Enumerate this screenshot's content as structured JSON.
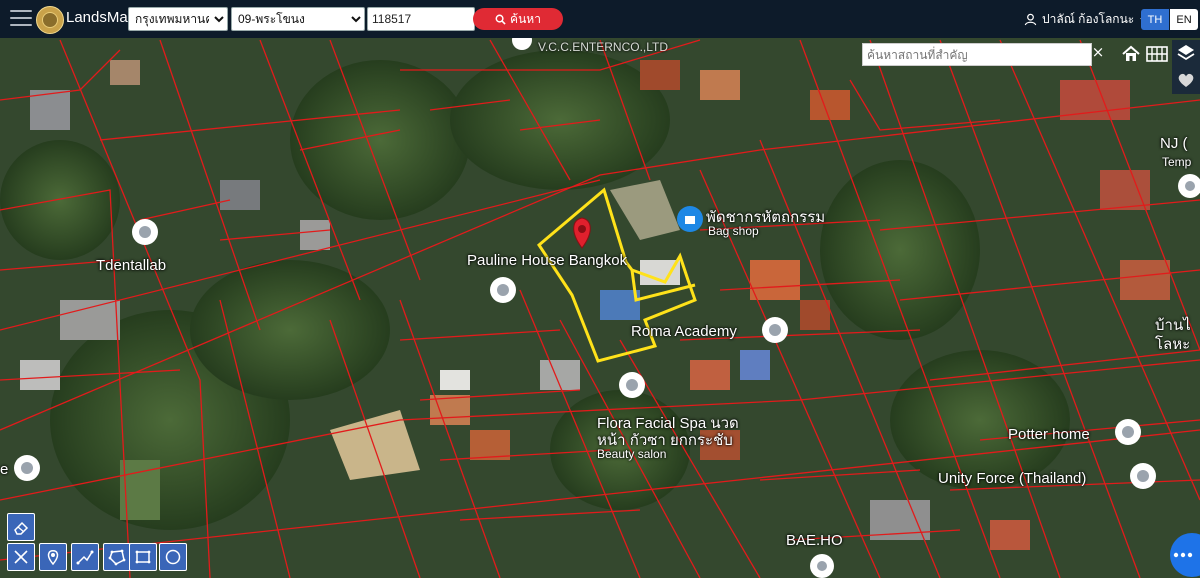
{
  "app": {
    "title": "LandsMaps"
  },
  "search": {
    "province": "กรุงเทพมหานคร",
    "district": "09-พระโขนง",
    "parcel_number": "118517",
    "button_label": "ค้นหา"
  },
  "user": {
    "name": "ปาลัณ์ ก้องโลกนะ"
  },
  "language": {
    "th": "TH",
    "en": "EN"
  },
  "map": {
    "place_search_placeholder": "ค้นหาสถานที่สำคัญ",
    "clear_symbol": "×",
    "labels": [
      {
        "text": "Tdentallab"
      },
      {
        "text": "Pauline House Bangkok"
      },
      {
        "text": "พัดชากรหัตถกรรม"
      },
      {
        "text": "Bag shop"
      },
      {
        "text": "Roma Academy"
      },
      {
        "text": "Flora Facial Spa นวด"
      },
      {
        "text": "หน้า กัวซา ยกกระชับ"
      },
      {
        "text": "Beauty salon"
      },
      {
        "text": "Potter home"
      },
      {
        "text": "Unity Force (Thailand)"
      },
      {
        "text": "BAE.HO"
      },
      {
        "text": "NJ ("
      },
      {
        "text": "Temp"
      },
      {
        "text": "บ้านไ"
      },
      {
        "text": "โลหะ"
      },
      {
        "text": "V.C.C.ENTERNCO.,LTD"
      },
      {
        "text": "e"
      }
    ]
  },
  "colors": {
    "parcel_line": "#e21b1b",
    "selected_parcel": "#ffe21a",
    "pin": "#e0202d",
    "topbar": "#0d1b2a"
  },
  "icons": {
    "menu": "menu-icon",
    "search": "search-icon",
    "user": "user-icon",
    "home": "home-icon",
    "grid": "grid-icon",
    "layers": "layers-icon",
    "heart": "heart-icon",
    "tools": [
      "eraser-icon",
      "ruler-icon",
      "location-pin-icon",
      "distance-icon",
      "polygon-icon",
      "rectangle-icon",
      "circle-icon"
    ]
  }
}
